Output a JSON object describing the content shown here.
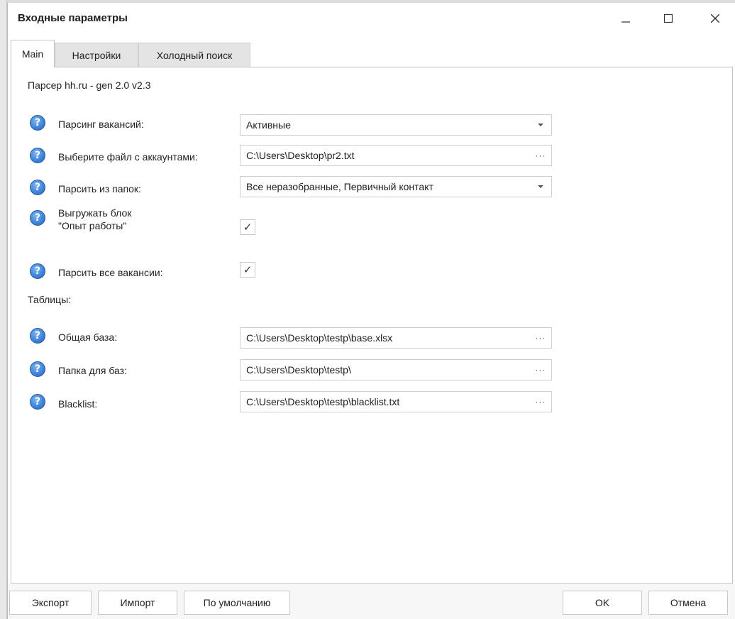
{
  "window": {
    "title": "Входные параметры"
  },
  "tabs": [
    {
      "label": "Main",
      "active": true
    },
    {
      "label": "Настройки",
      "active": false
    },
    {
      "label": "Холодный поиск",
      "active": false
    }
  ],
  "main": {
    "parser_title": "Парсер hh.ru - gen 2.0 v2.3",
    "rows": [
      {
        "label": "Парсинг вакансий:",
        "type": "dropdown",
        "value": "Активные"
      },
      {
        "label": "Выберите файл с аккаунтами:",
        "type": "file",
        "value": "C:\\Users\\Desktop\\pr2.txt"
      },
      {
        "label": "Парсить из папок:",
        "type": "dropdown",
        "value": "Все неразобранные, Первичный контакт"
      },
      {
        "label": "Выгружать блок\n\"Опыт работы\"",
        "type": "checkbox",
        "checked": true,
        "mark": "✓"
      },
      {
        "label": "Парсить все вакансии:",
        "type": "checkbox",
        "checked": true,
        "mark": "✓"
      }
    ],
    "tables_section_label": "Таблицы:",
    "table_rows": [
      {
        "label": "Общая база:",
        "type": "file",
        "value": "C:\\Users\\Desktop\\testp\\base.xlsx"
      },
      {
        "label": "Папка для баз:",
        "type": "file",
        "value": "C:\\Users\\Desktop\\testp\\"
      },
      {
        "label": "Blacklist:",
        "type": "file",
        "value": "C:\\Users\\Desktop\\testp\\blacklist.txt"
      }
    ],
    "help_glyph": "?",
    "browse_glyph": "···"
  },
  "footer": {
    "export_label": "Экспорт",
    "import_label": "Импорт",
    "default_label": "По умолчанию",
    "ok_label": "OK",
    "cancel_label": "Отмена"
  },
  "colors": {
    "help_icon": "#3f86dc",
    "window_bg": "#ffffff",
    "footer_bg": "#f7f7f7"
  }
}
